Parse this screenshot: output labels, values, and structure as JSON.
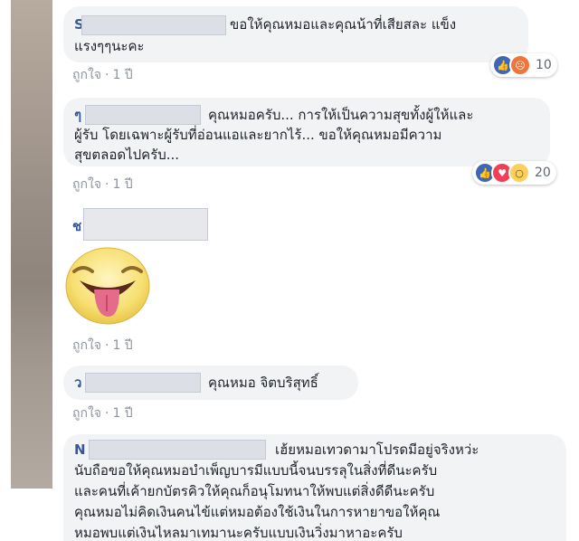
{
  "comments": [
    {
      "name_initial": "S",
      "lines": [
        "ขอให้คุณหมอและคุณน้าที่เสียสละ แข็ง",
        "แรงๆๆนะคะ"
      ],
      "like": "ถูกใจ",
      "sep": "·",
      "time": "1 ปี",
      "reactions": [
        "like",
        "angry"
      ],
      "count": "10"
    },
    {
      "name_initial": "ๆ",
      "lines": [
        "คุณหมอครับ... การให้เป็นความสุขทั้งผู้ให้และ",
        "ผู้รับ โดยเฉพาะผู้รับที่อ่อนแอและยากไร้... ขอให้คุณหมอมีความ",
        "สุขตลอดไปครับ..."
      ],
      "like": "ถูกใจ",
      "sep": "·",
      "time": "1 ปี",
      "reactions": [
        "like",
        "love",
        "wow"
      ],
      "count": "20"
    },
    {
      "name_initial": "ช",
      "sticker": "tongue-out-emoji",
      "like": "ถูกใจ",
      "sep": "·",
      "time": "1 ปี"
    },
    {
      "name_initial": "ว",
      "lines": [
        "คุณหมอ จิตบริสุทธิ์"
      ],
      "like": "ถูกใจ",
      "sep": "·",
      "time": "1 ปี"
    },
    {
      "name_initial": "N",
      "lines": [
        "เฮ้ยหมอเทวดามาโปรดมีอยู่จริงหว่ะ",
        "นับถือขอให้คุณหมอบำเพ็ญบารมีแบบนี้จนบรรลุในสิ่งที่ดีนะครับ",
        "และคนที่เค้ายกบัตรคิวให้คุณก็อนุโมทนาให้พบแต่สิ่งดีดีนะครับ",
        "คุณหมอไม่คิดเงินคนไข้แต่หมอต้องใช้เงินในการหายาขอให้คุณ",
        "หมอพบแต่เงินไหลมาเทมานะครับแบบเงินวิ่งมาหาอะครับ"
      ]
    }
  ],
  "colors": {
    "bubble": "#f2f3f5",
    "name": "#365899",
    "meta": "#8d949e",
    "like_reaction": "#4267b2",
    "love_reaction": "#f33e58",
    "angry_reaction": "#f0743b",
    "wow_reaction": "#fcd05c"
  }
}
